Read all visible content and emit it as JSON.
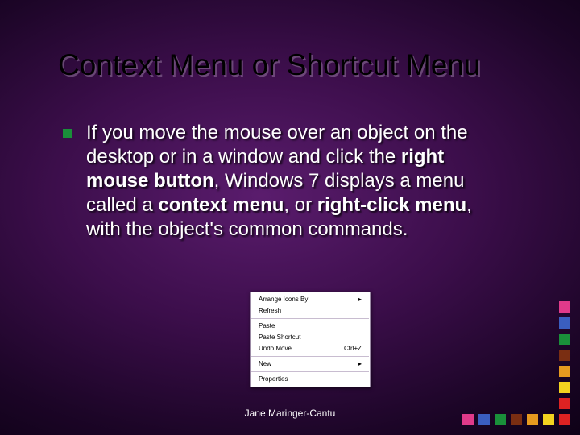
{
  "title": "Context Menu or Shortcut Menu",
  "body": {
    "t1": "If you move the mouse over an object on the desktop or in a window and click the ",
    "b1": "right mouse button",
    "t2": ", Windows 7 displays a menu called a ",
    "b2": "context menu",
    "t3": ", or ",
    "b3": "right-click menu",
    "t4": ", with the object's common commands."
  },
  "context_menu": {
    "items": [
      "Arrange Icons By",
      "Refresh",
      "Paste",
      "Paste Shortcut",
      "Undo Move",
      "New",
      "Properties"
    ],
    "undo_shortcut": "Ctrl+Z"
  },
  "footer": "Jane Maringer-Cantu",
  "colors": {
    "vcol": [
      "#e03a8a",
      "#3a5ec0",
      "#1a8f3a",
      "#7a2e12",
      "#e69a1f",
      "#f2d21f",
      "#d22"
    ],
    "hrow": [
      "#e03a8a",
      "#3a5ec0",
      "#1a8f3a",
      "#7a2e12",
      "#e69a1f",
      "#f2d21f",
      "#d22"
    ]
  }
}
